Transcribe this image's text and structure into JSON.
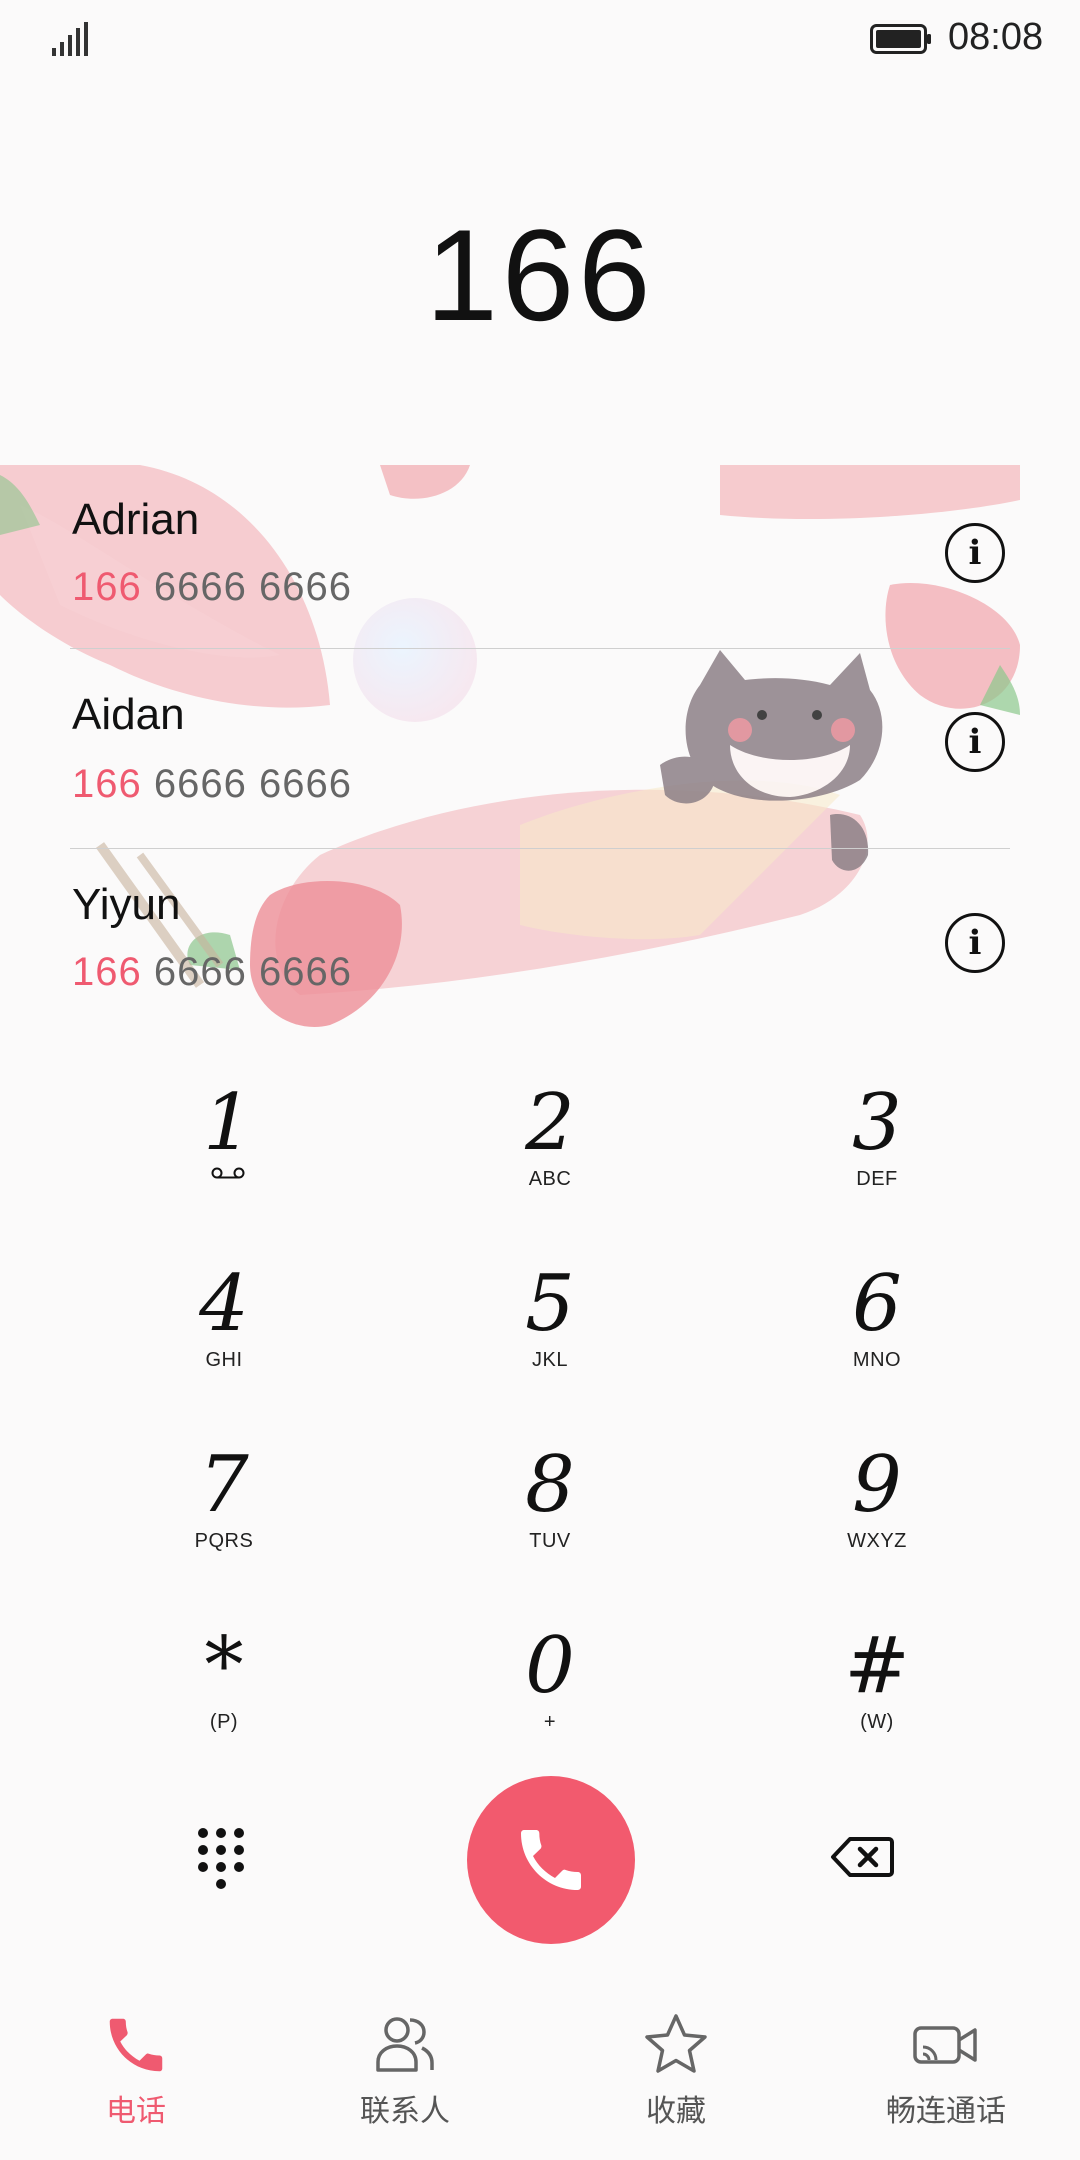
{
  "status_bar": {
    "time": "08:08"
  },
  "dialed_number": "166",
  "contacts": [
    {
      "name": "Adrian",
      "number_match": "166",
      "number_rest": " 6666 6666"
    },
    {
      "name": "Aidan",
      "number_match": "166",
      "number_rest": " 6666 6666"
    },
    {
      "name": "Yiyun",
      "number_match": "166",
      "number_rest": " 6666 6666"
    }
  ],
  "dialpad": {
    "keys": [
      {
        "digit": "1",
        "letters": ""
      },
      {
        "digit": "2",
        "letters": "ABC"
      },
      {
        "digit": "3",
        "letters": "DEF"
      },
      {
        "digit": "4",
        "letters": "GHI"
      },
      {
        "digit": "5",
        "letters": "JKL"
      },
      {
        "digit": "6",
        "letters": "MNO"
      },
      {
        "digit": "7",
        "letters": "PQRS"
      },
      {
        "digit": "8",
        "letters": "TUV"
      },
      {
        "digit": "9",
        "letters": "WXYZ"
      },
      {
        "digit": "*",
        "letters": "(P)"
      },
      {
        "digit": "0",
        "letters": "+"
      },
      {
        "digit": "#",
        "letters": "(W)"
      }
    ]
  },
  "bottom_nav": {
    "items": [
      {
        "label": "电话",
        "icon": "phone-icon",
        "active": true
      },
      {
        "label": "联系人",
        "icon": "contacts-icon",
        "active": false
      },
      {
        "label": "收藏",
        "icon": "star-icon",
        "active": false
      },
      {
        "label": "畅连通话",
        "icon": "video-call-icon",
        "active": false
      }
    ]
  },
  "colors": {
    "accent": "#f25a6e",
    "highlight": "#ef5a70"
  }
}
